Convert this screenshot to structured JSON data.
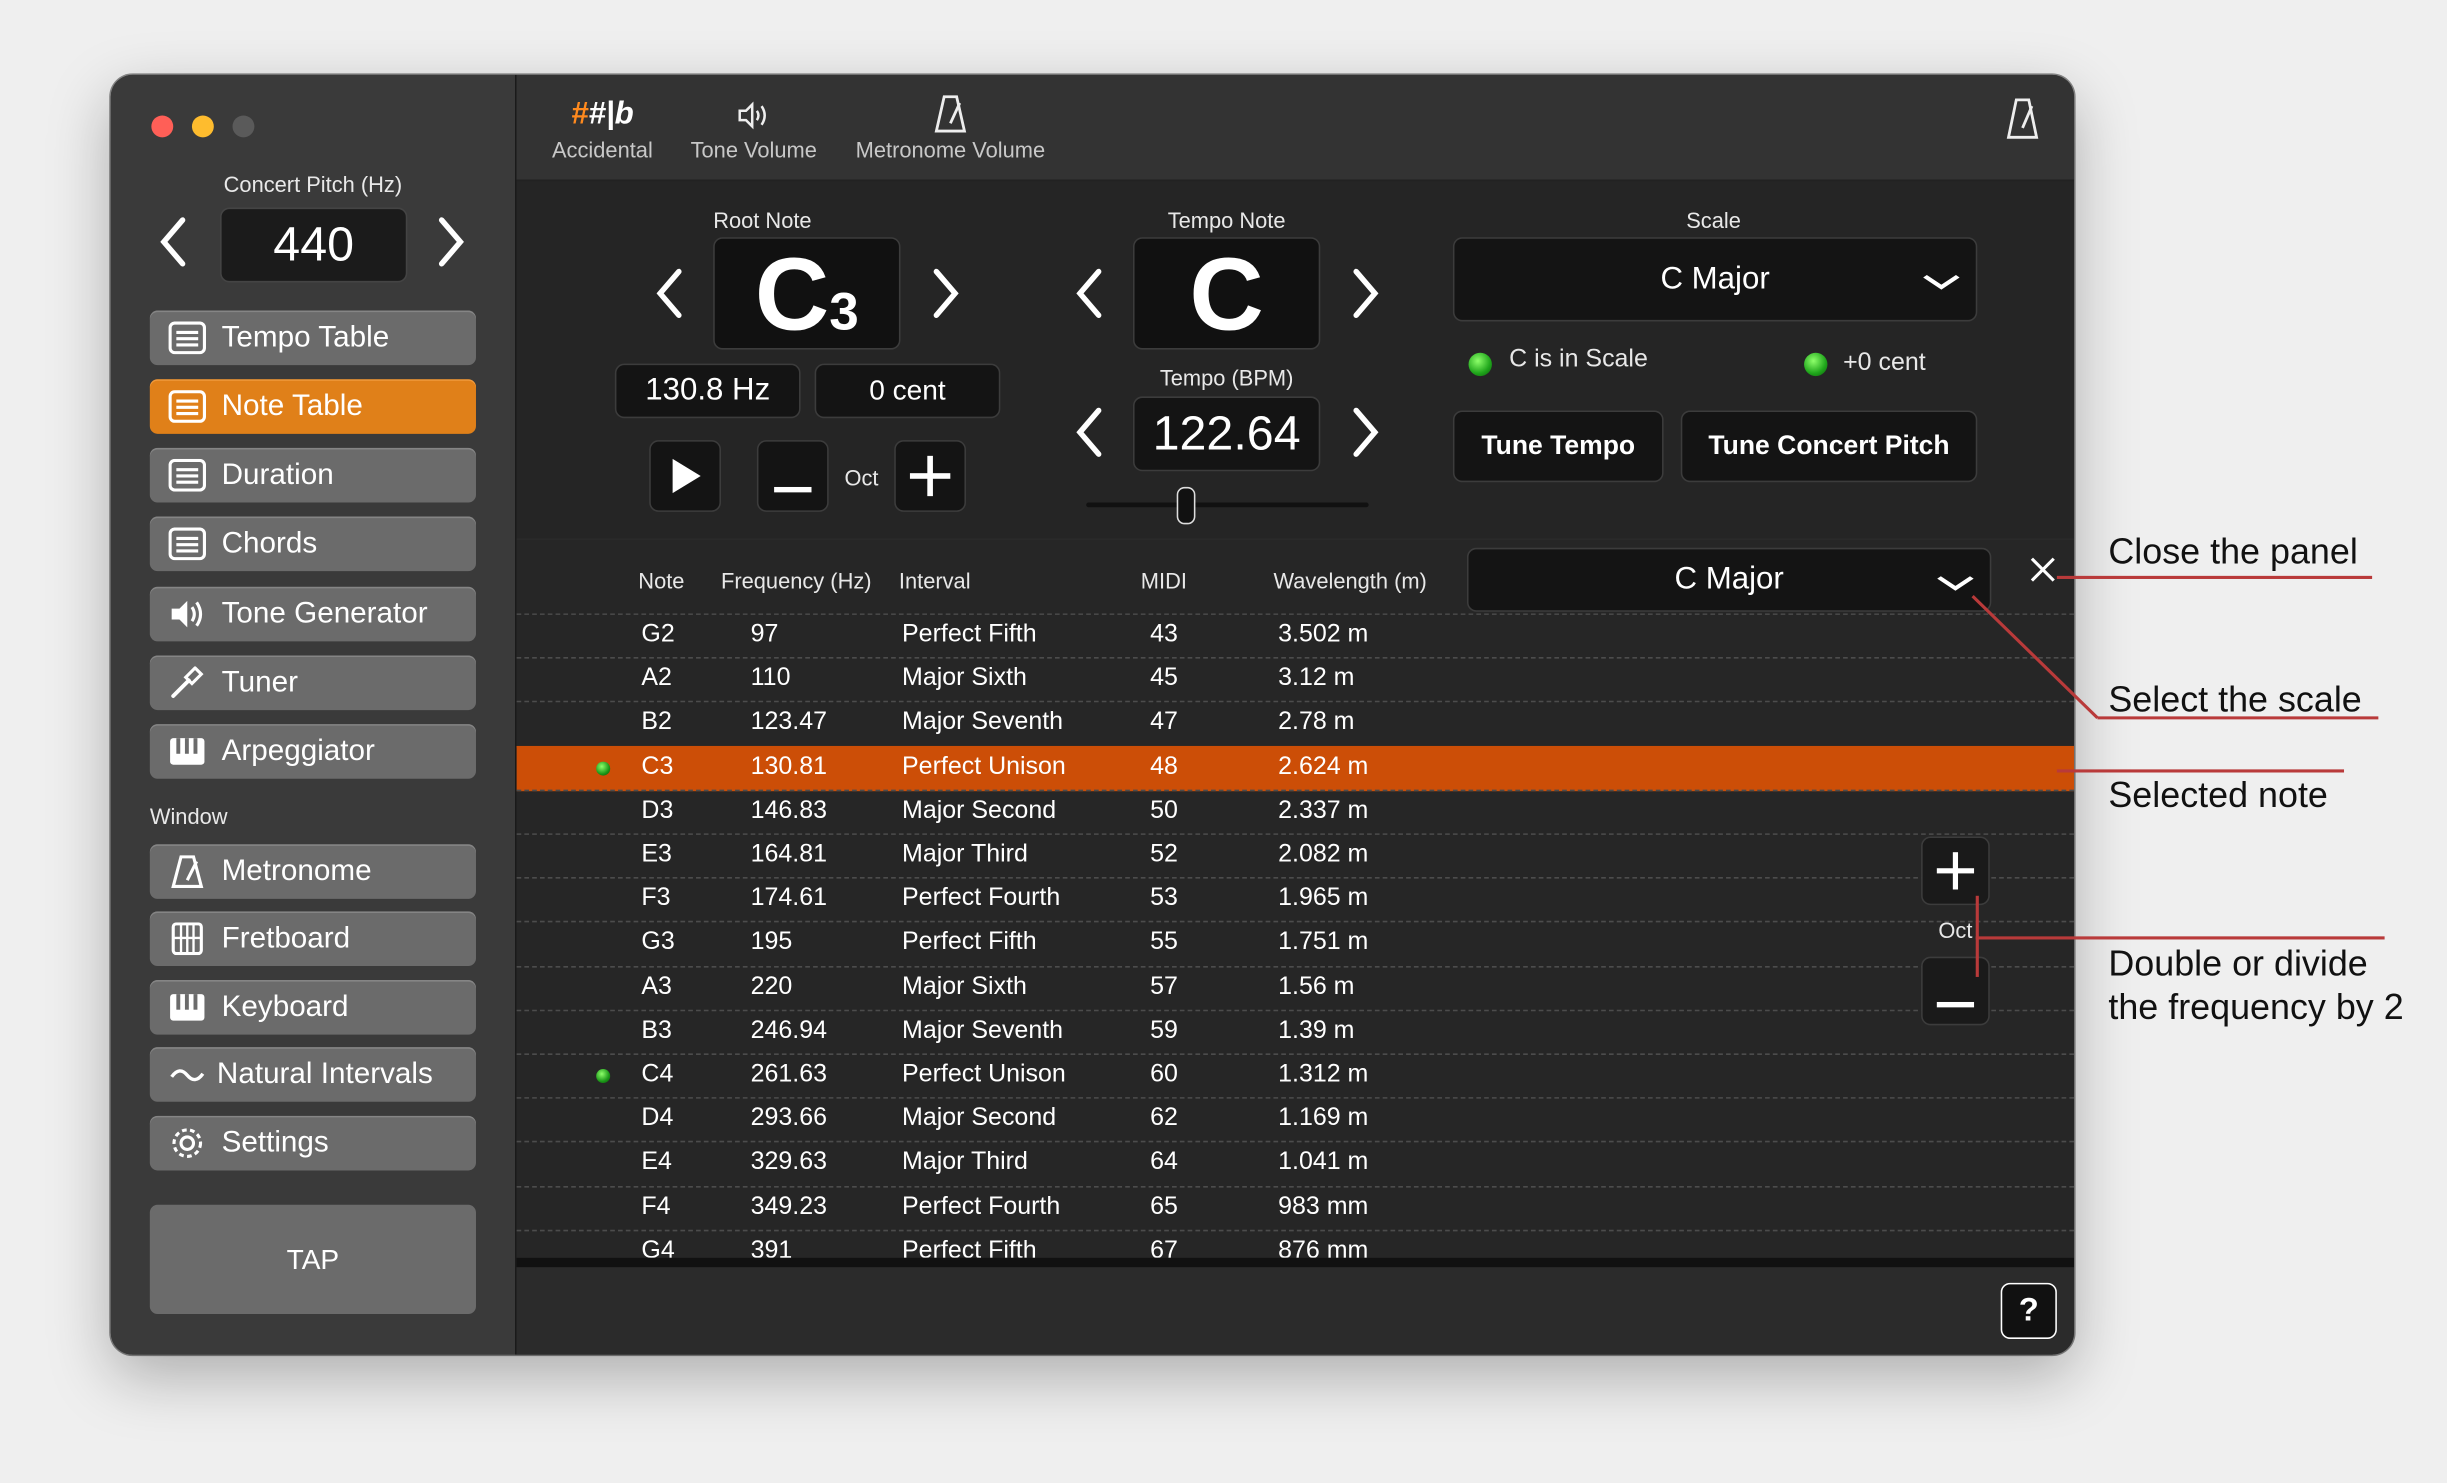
{
  "sidebar": {
    "concert_pitch_label": "Concert Pitch (Hz)",
    "concert_pitch_value": "440",
    "items": [
      {
        "label": "Tempo Table",
        "icon": "list-icon",
        "active": false
      },
      {
        "label": "Note Table",
        "icon": "list-icon",
        "active": true
      },
      {
        "label": "Duration",
        "icon": "list-icon",
        "active": false
      },
      {
        "label": "Chords",
        "icon": "list-icon",
        "active": false
      },
      {
        "label": "Tone Generator",
        "icon": "speaker-icon",
        "active": false
      },
      {
        "label": "Tuner",
        "icon": "tuner-icon",
        "active": false
      },
      {
        "label": "Arpeggiator",
        "icon": "piano-icon",
        "active": false
      }
    ],
    "window_section_label": "Window",
    "window_items": [
      {
        "label": "Metronome",
        "icon": "metronome-icon"
      },
      {
        "label": "Fretboard",
        "icon": "fretboard-icon"
      },
      {
        "label": "Keyboard",
        "icon": "piano-icon"
      },
      {
        "label": "Natural Intervals",
        "icon": "wave-icon"
      },
      {
        "label": "Settings",
        "icon": "gear-icon"
      }
    ],
    "tap_label": "TAP"
  },
  "toolbar": {
    "accidental_icon": "#|b",
    "accidental_label": "Accidental",
    "tone_volume_label": "Tone Volume",
    "metronome_volume_label": "Metronome Volume"
  },
  "controls": {
    "root_note_label": "Root Note",
    "root_note": "C",
    "root_octave": "3",
    "root_freq": "130.8 Hz",
    "root_cent": "0 cent",
    "oct_label": "Oct",
    "tempo_note_label": "Tempo Note",
    "tempo_note": "C",
    "tempo_bpm_label": "Tempo (BPM)",
    "tempo_bpm": "122.64",
    "tempo_slider_value": 0.35,
    "scale_label": "Scale",
    "scale_value": "C Major",
    "in_scale_text": "C is in Scale",
    "cent_status": "+0 cent",
    "tune_tempo_label": "Tune Tempo",
    "tune_concert_label": "Tune Concert Pitch"
  },
  "table": {
    "headers": {
      "note": "Note",
      "frequency": "Frequency (Hz)",
      "interval": "Interval",
      "midi": "MIDI",
      "wavelength": "Wavelength (m)"
    },
    "scale_dropdown": "C Major",
    "oct_label": "Oct",
    "rows": [
      {
        "note": "G2",
        "freq": "97",
        "interval": "Perfect Fifth",
        "midi": "43",
        "wavelength": "3.502 m",
        "dot": false,
        "selected": false
      },
      {
        "note": "A2",
        "freq": "110",
        "interval": "Major Sixth",
        "midi": "45",
        "wavelength": "3.12 m",
        "dot": false,
        "selected": false
      },
      {
        "note": "B2",
        "freq": "123.47",
        "interval": "Major Seventh",
        "midi": "47",
        "wavelength": "2.78 m",
        "dot": false,
        "selected": false
      },
      {
        "note": "C3",
        "freq": "130.81",
        "interval": "Perfect Unison",
        "midi": "48",
        "wavelength": "2.624 m",
        "dot": true,
        "selected": true
      },
      {
        "note": "D3",
        "freq": "146.83",
        "interval": "Major Second",
        "midi": "50",
        "wavelength": "2.337 m",
        "dot": false,
        "selected": false
      },
      {
        "note": "E3",
        "freq": "164.81",
        "interval": "Major Third",
        "midi": "52",
        "wavelength": "2.082 m",
        "dot": false,
        "selected": false
      },
      {
        "note": "F3",
        "freq": "174.61",
        "interval": "Perfect Fourth",
        "midi": "53",
        "wavelength": "1.965 m",
        "dot": false,
        "selected": false
      },
      {
        "note": "G3",
        "freq": "195",
        "interval": "Perfect Fifth",
        "midi": "55",
        "wavelength": "1.751 m",
        "dot": false,
        "selected": false
      },
      {
        "note": "A3",
        "freq": "220",
        "interval": "Major Sixth",
        "midi": "57",
        "wavelength": "1.56 m",
        "dot": false,
        "selected": false
      },
      {
        "note": "B3",
        "freq": "246.94",
        "interval": "Major Seventh",
        "midi": "59",
        "wavelength": "1.39 m",
        "dot": false,
        "selected": false
      },
      {
        "note": "C4",
        "freq": "261.63",
        "interval": "Perfect Unison",
        "midi": "60",
        "wavelength": "1.312 m",
        "dot": true,
        "selected": false
      },
      {
        "note": "D4",
        "freq": "293.66",
        "interval": "Major Second",
        "midi": "62",
        "wavelength": "1.169 m",
        "dot": false,
        "selected": false
      },
      {
        "note": "E4",
        "freq": "329.63",
        "interval": "Major Third",
        "midi": "64",
        "wavelength": "1.041 m",
        "dot": false,
        "selected": false
      },
      {
        "note": "F4",
        "freq": "349.23",
        "interval": "Perfect Fourth",
        "midi": "65",
        "wavelength": "983 mm",
        "dot": false,
        "selected": false
      },
      {
        "note": "G4",
        "freq": "391",
        "interval": "Perfect Fifth",
        "midi": "67",
        "wavelength": "876 mm",
        "dot": false,
        "selected": false
      }
    ]
  },
  "footer": {
    "help_label": "?"
  },
  "annotations": {
    "close_panel": "Close the panel",
    "select_scale": "Select the scale",
    "selected_note": "Selected note",
    "double_divide_line1": "Double or divide",
    "double_divide_line2": "the frequency by 2"
  },
  "colors": {
    "accent": "#e08019",
    "selected_row": "#cc4e07",
    "annotation_line": "#b93a3a"
  }
}
